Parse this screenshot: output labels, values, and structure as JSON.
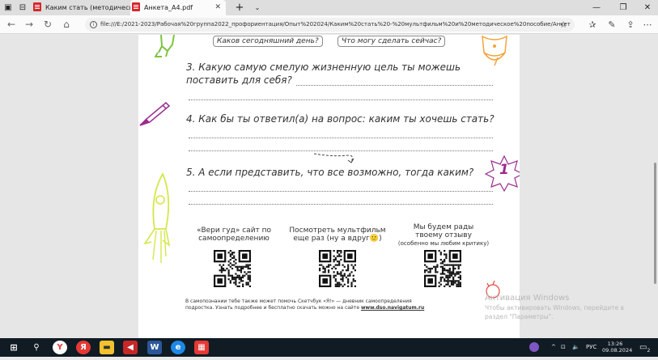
{
  "browser": {
    "tabs": [
      {
        "label": "Каким стать (методически"
      },
      {
        "label": "Анкета_A4.pdf"
      }
    ],
    "new_tab": "+",
    "url": "file:///E:/2021-2023/Рабочая%20группа2022_профориентация/Опыт%202024/Каким%20стать%20-%20мультфильм%20и%20методическое%20пособие/Анкет"
  },
  "page": {
    "pills": [
      "Каков сегодняшний день?",
      "Что могу сделать сейчас?"
    ],
    "questions": [
      {
        "line1": "3. Какую самую смелую жизненную цель ты можешь",
        "line2": "поставить для себя?"
      },
      {
        "line1": "4. Как бы ты ответил(а) на вопрос: каким ты хочешь стать?"
      },
      {
        "line1": "5. А если представить, что все возможно, тогда каким?"
      }
    ],
    "badge": "1",
    "qr_blocks": [
      {
        "line1": "«Вери гуд» сайт по",
        "line2": "самоопределению"
      },
      {
        "line1": "Посмотреть мультфильм",
        "line2": "еще раз (ну а вдруг",
        "emoji": "🙂",
        "line2_end": ")"
      },
      {
        "line1": "Мы будем рады",
        "line2": "твоему отзыву",
        "line3": "(особенно мы любим критику)"
      }
    ],
    "footer_line1": "В самопознании тебе также может помочь Скетчбук «Я!» — дневник самоопределения",
    "footer_line2": "подростка. Узнать подробнее и бесплатно скачать можно на сайте",
    "footer_link": "www.dso.navigatum.ru"
  },
  "watermark": {
    "line1": "Активация Windows",
    "line2": "Чтобы активировать Windows, перейдите в",
    "line3": "раздел \"Параметры\"."
  },
  "taskbar": {
    "lang": "РУС",
    "time": "13:26",
    "date": "09.08.2024",
    "notification_count": "2"
  },
  "colors": {
    "accent_pdf": "#d7262b",
    "taskbar": "#101b24",
    "doodle_green": "#7ec342",
    "doodle_purple": "#9a2a8e",
    "doodle_orange": "#f2a43a",
    "doodle_yellow": "#d6e64b"
  }
}
